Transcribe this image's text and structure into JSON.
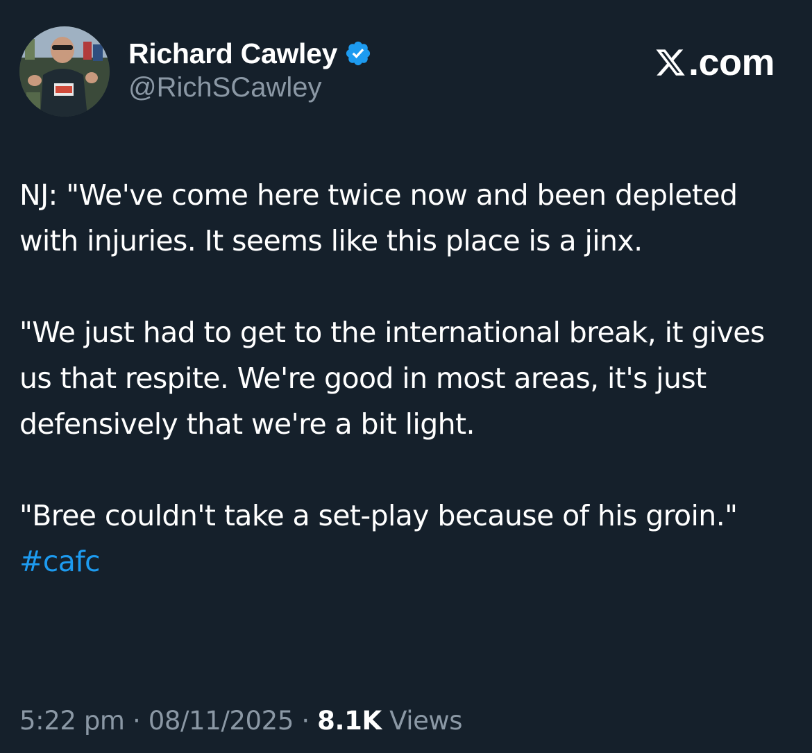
{
  "author": {
    "display_name": "Richard Cawley",
    "handle": "@RichSCawley",
    "avatar_icon": "profile-photo",
    "verified_icon": "verified-badge-icon",
    "verified_color": "#1d9bf0"
  },
  "brand": {
    "icon": "x-logo-icon",
    "text": ".com"
  },
  "tweet": {
    "paragraphs": [
      {
        "text": "NJ: \"We've come here twice now and been depleted with injuries. It seems like this place is a jinx."
      },
      {
        "text": "\"We just had to get to the international break, it gives us that respite. We're good in most areas, it's just defensively that we're a bit light."
      },
      {
        "text": "\"Bree couldn't take a set-play because of his groin.\"",
        "hashtag": "#cafc"
      }
    ]
  },
  "meta": {
    "time": "5:22 pm",
    "separator": "·",
    "date": "08/11/2025",
    "views_count": "8.1K",
    "views_label": "Views"
  },
  "colors": {
    "background": "#15202b",
    "text_primary": "#ffffff",
    "text_secondary": "#8b98a5",
    "accent": "#1d9bf0"
  }
}
